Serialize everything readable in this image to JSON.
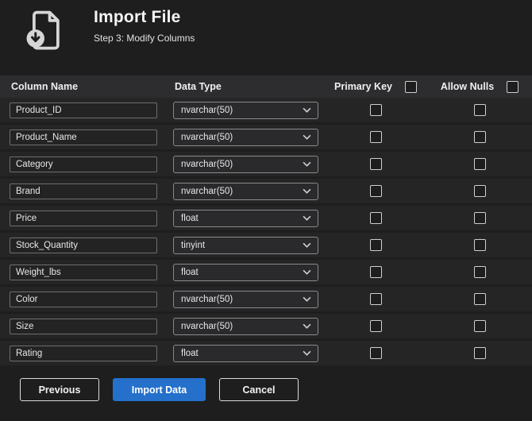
{
  "header": {
    "title": "Import File",
    "subtitle": "Step 3: Modify Columns"
  },
  "table": {
    "headers": {
      "column_name": "Column Name",
      "data_type": "Data Type",
      "primary_key": "Primary Key",
      "allow_nulls": "Allow Nulls"
    },
    "rows": [
      {
        "name": "Product_ID",
        "type": "nvarchar(50)",
        "primary_key": false,
        "allow_nulls": false
      },
      {
        "name": "Product_Name",
        "type": "nvarchar(50)",
        "primary_key": false,
        "allow_nulls": false
      },
      {
        "name": "Category",
        "type": "nvarchar(50)",
        "primary_key": false,
        "allow_nulls": false
      },
      {
        "name": "Brand",
        "type": "nvarchar(50)",
        "primary_key": false,
        "allow_nulls": false
      },
      {
        "name": "Price",
        "type": "float",
        "primary_key": false,
        "allow_nulls": false
      },
      {
        "name": "Stock_Quantity",
        "type": "tinyint",
        "primary_key": false,
        "allow_nulls": false
      },
      {
        "name": "Weight_lbs",
        "type": "float",
        "primary_key": false,
        "allow_nulls": false
      },
      {
        "name": "Color",
        "type": "nvarchar(50)",
        "primary_key": false,
        "allow_nulls": false
      },
      {
        "name": "Size",
        "type": "nvarchar(50)",
        "primary_key": false,
        "allow_nulls": false
      },
      {
        "name": "Rating",
        "type": "float",
        "primary_key": false,
        "allow_nulls": false
      }
    ]
  },
  "buttons": {
    "previous": "Previous",
    "import": "Import Data",
    "cancel": "Cancel"
  },
  "colors": {
    "accent_blue": "#2470cb",
    "background": "#1e1e1e",
    "table_header": "#2d2d30",
    "row": "#252526"
  }
}
